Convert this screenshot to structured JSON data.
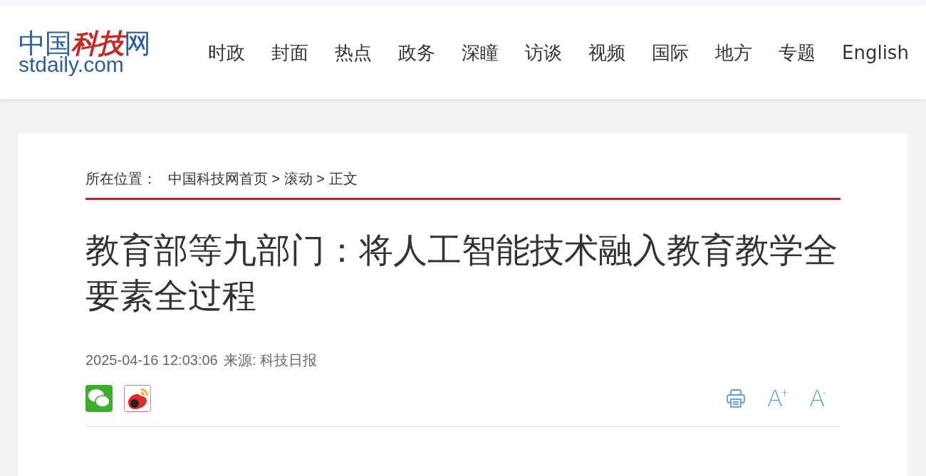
{
  "logo": {
    "parts": [
      {
        "text": "中国",
        "accent": false
      },
      {
        "text": "科技",
        "accent": true
      },
      {
        "text": "网",
        "accent": false
      }
    ],
    "domain": "stdaily.com"
  },
  "nav": [
    "时政",
    "封面",
    "热点",
    "政务",
    "深瞳",
    "访谈",
    "视频",
    "国际",
    "地方",
    "专题",
    "English"
  ],
  "breadcrumb": {
    "label": "所在位置：",
    "trail": "中国科技网首页 > 滚动 > 正文"
  },
  "article": {
    "title": "教育部等九部门：将人工智能技术融入教育教学全要素全过程",
    "datetime": "2025-04-16 12:03:06",
    "source": "来源: 科技日报"
  },
  "tools": [
    {
      "kind": "print"
    },
    {
      "kind": "font",
      "letter": "A",
      "sign": "+"
    },
    {
      "kind": "font",
      "letter": "A",
      "sign": "-"
    }
  ]
}
